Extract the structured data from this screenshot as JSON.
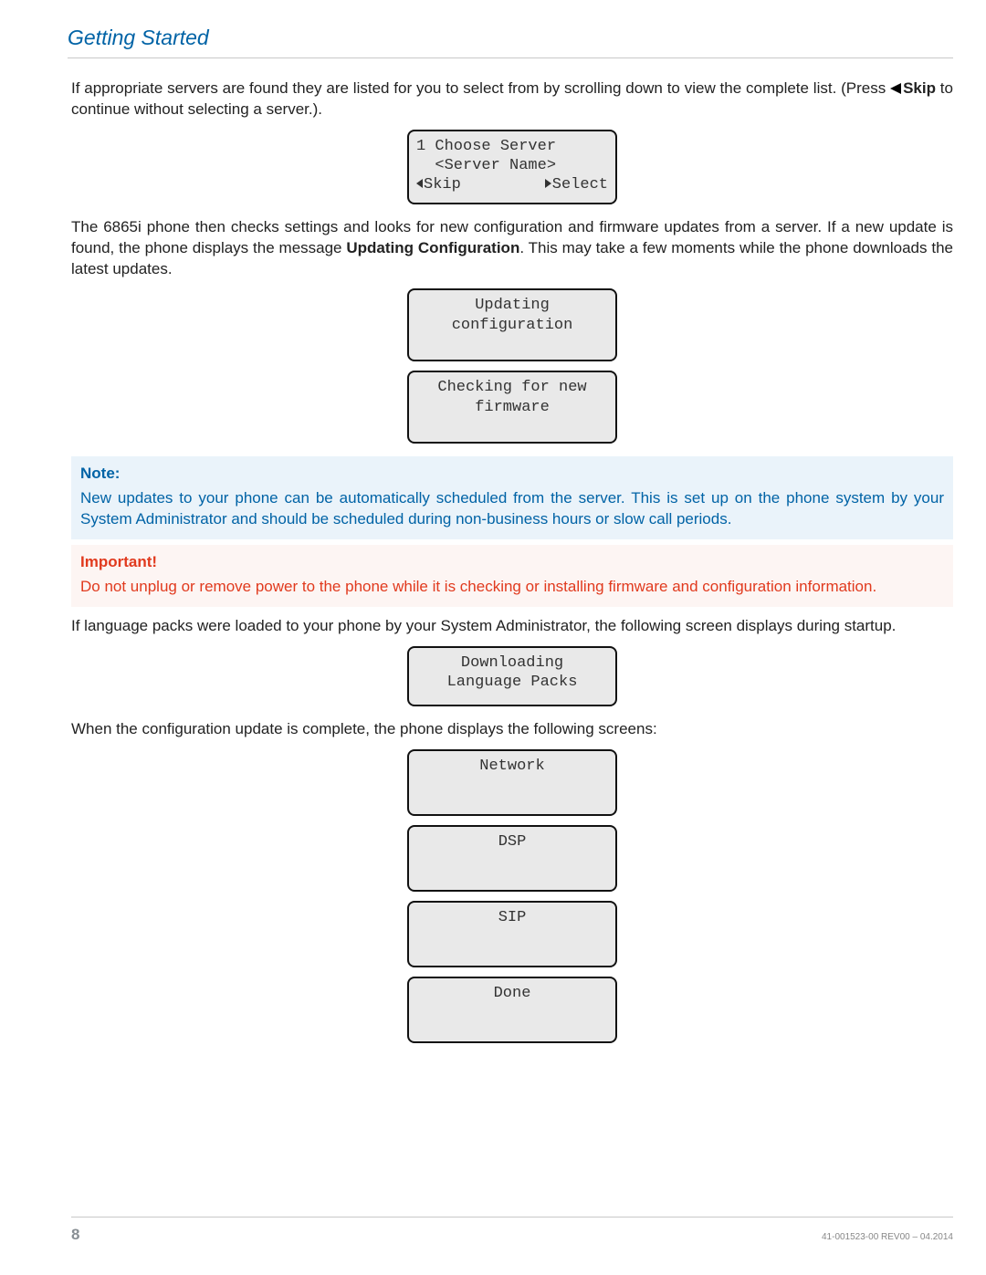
{
  "header": {
    "title": "Getting Started"
  },
  "intro": {
    "p1a": "If appropriate servers are found they are listed for you to select from by scrolling down to view the complete list. (Press ",
    "p1b_bold": "Skip",
    "p1c": " to continue without selecting a server.)."
  },
  "lcd1": {
    "line1": "1 Choose Server",
    "line2": "  <Server Name>",
    "left": "Skip",
    "right": "Select"
  },
  "para2": {
    "a": "The 6865i phone then checks settings and looks for new configuration and firmware updates from a server. If a new update is found, the phone displays the message ",
    "b_bold": "Updating Configuration",
    "c": ". This may take a few moments while the phone downloads the latest updates."
  },
  "lcd2": {
    "line1": "Updating",
    "line2": "configuration"
  },
  "lcd3": {
    "line1": "Checking for new",
    "line2": "firmware"
  },
  "note": {
    "title": "Note:",
    "body": "New updates to your phone can be automatically scheduled from the server. This is set up on the phone system by your System Administrator and should be scheduled during non-business hours or slow call periods."
  },
  "important": {
    "title": "Important!",
    "body": "Do not unplug or remove power to the phone while it is checking or installing firmware and configuration information."
  },
  "para3": "If language packs were loaded to your phone by your System Administrator, the following screen displays during startup.",
  "lcd4": {
    "line1": "Downloading",
    "line2": "Language Packs"
  },
  "para4": "When the configuration update is complete, the phone displays the following screens:",
  "lcd5": {
    "line1": "Network"
  },
  "lcd6": {
    "line1": "DSP"
  },
  "lcd7": {
    "line1": "SIP"
  },
  "lcd8": {
    "line1": "Done"
  },
  "footer": {
    "page": "8",
    "docid": "41-001523-00 REV00 – 04.2014"
  }
}
